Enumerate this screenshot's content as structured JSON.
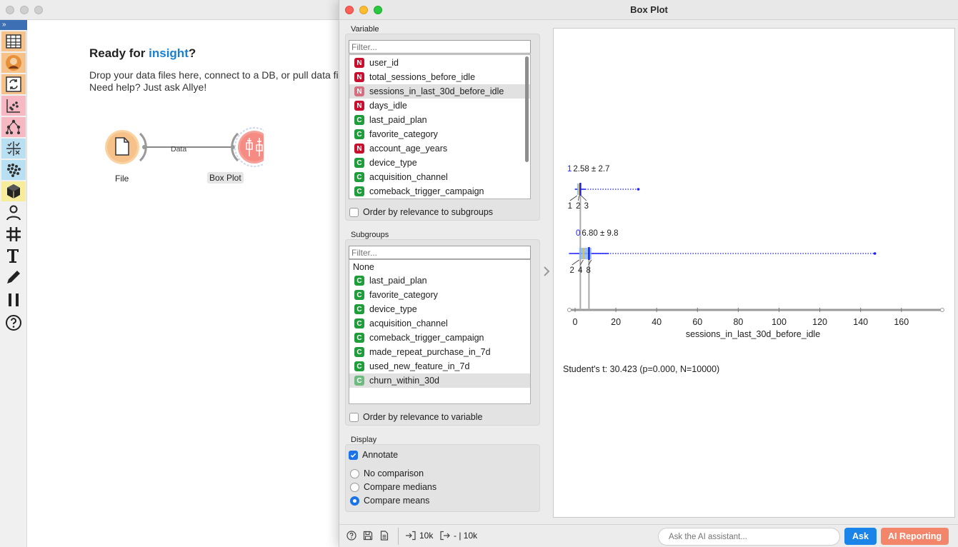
{
  "canvas": {
    "welcome_title_prefix": "Ready for ",
    "welcome_title_highlight": "insight",
    "welcome_title_suffix": "?",
    "welcome_line1": "Drop your data files here, connect to a DB, or pull data fi",
    "welcome_line2": "Need help? Just ask Allye!",
    "nodes": [
      {
        "label": "File",
        "icon": "file-icon"
      },
      {
        "label": "Box Plot",
        "icon": "box-plot-icon"
      }
    ],
    "link_label": "Data",
    "toolbox": [
      "table-icon",
      "avatar-icon",
      "refresh-icon",
      "scatter-icon",
      "tree-icon",
      "grid-check-icon",
      "cluster-icon",
      "cube-icon",
      "person-icon",
      "hash-icon",
      "text-icon",
      "pen-icon",
      "pause-icon",
      "help-icon"
    ]
  },
  "window": {
    "title": "Box Plot"
  },
  "variable_panel": {
    "label": "Variable",
    "filter_placeholder": "Filter...",
    "items": [
      {
        "type": "N",
        "name": "user_id",
        "selected": false
      },
      {
        "type": "N",
        "name": "total_sessions_before_idle",
        "selected": false
      },
      {
        "type": "N",
        "name": "sessions_in_last_30d_before_idle",
        "selected": true
      },
      {
        "type": "N",
        "name": "days_idle",
        "selected": false
      },
      {
        "type": "C",
        "name": "last_paid_plan",
        "selected": false
      },
      {
        "type": "C",
        "name": "favorite_category",
        "selected": false
      },
      {
        "type": "N",
        "name": "account_age_years",
        "selected": false
      },
      {
        "type": "C",
        "name": "device_type",
        "selected": false
      },
      {
        "type": "C",
        "name": "acquisition_channel",
        "selected": false
      },
      {
        "type": "C",
        "name": "comeback_trigger_campaign",
        "selected": false
      }
    ],
    "order_label": "Order by relevance to subgroups"
  },
  "subgroups_panel": {
    "label": "Subgroups",
    "filter_placeholder": "Filter...",
    "none_label": "None",
    "items": [
      {
        "type": "C",
        "name": "last_paid_plan",
        "selected": false
      },
      {
        "type": "C",
        "name": "favorite_category",
        "selected": false
      },
      {
        "type": "C",
        "name": "device_type",
        "selected": false
      },
      {
        "type": "C",
        "name": "acquisition_channel",
        "selected": false
      },
      {
        "type": "C",
        "name": "comeback_trigger_campaign",
        "selected": false
      },
      {
        "type": "C",
        "name": "made_repeat_purchase_in_7d",
        "selected": false
      },
      {
        "type": "C",
        "name": "used_new_feature_in_7d",
        "selected": false
      },
      {
        "type": "C",
        "name": "churn_within_30d",
        "selected": true
      }
    ],
    "order_label": "Order by relevance to variable"
  },
  "display_panel": {
    "label": "Display",
    "annotate_label": "Annotate",
    "annotate_checked": true,
    "options": [
      {
        "label": "No comparison",
        "selected": false
      },
      {
        "label": "Compare medians",
        "selected": false
      },
      {
        "label": "Compare means",
        "selected": true
      }
    ]
  },
  "chart_data": {
    "type": "box",
    "xlabel": "sessions_in_last_30d_before_idle",
    "xlim": [
      0,
      180
    ],
    "xticks": [
      0,
      20,
      40,
      60,
      80,
      100,
      120,
      140,
      160
    ],
    "boxes": [
      {
        "group": "1",
        "annotation": "2.58 ± 2.7",
        "mean": 2.58,
        "sd": 2.7,
        "q1": 1,
        "median": 2,
        "q3": 3,
        "min": 0,
        "max": 31,
        "quartile_labels": [
          "1",
          "2",
          "3"
        ]
      },
      {
        "group": "0",
        "annotation": "6.80 ± 9.8",
        "mean": 6.8,
        "sd": 9.8,
        "q1": 2,
        "median": 4,
        "q3": 8,
        "min": 0,
        "max": 147,
        "quartile_labels": [
          "2",
          "4",
          "8"
        ]
      }
    ],
    "statistic": "Student's t: 30.423 (p=0.000, N=10000)",
    "colors": {
      "box": "#88b7f0",
      "mean": "#1a1aff",
      "whisker": "#1a1aff",
      "median": "#e0c050"
    }
  },
  "status_bar": {
    "input_count": "10k",
    "output_count": "- | 10k",
    "ask_placeholder": "Ask the AI assistant...",
    "ask_label": "Ask",
    "ai_reporting_label": "AI Reporting"
  }
}
